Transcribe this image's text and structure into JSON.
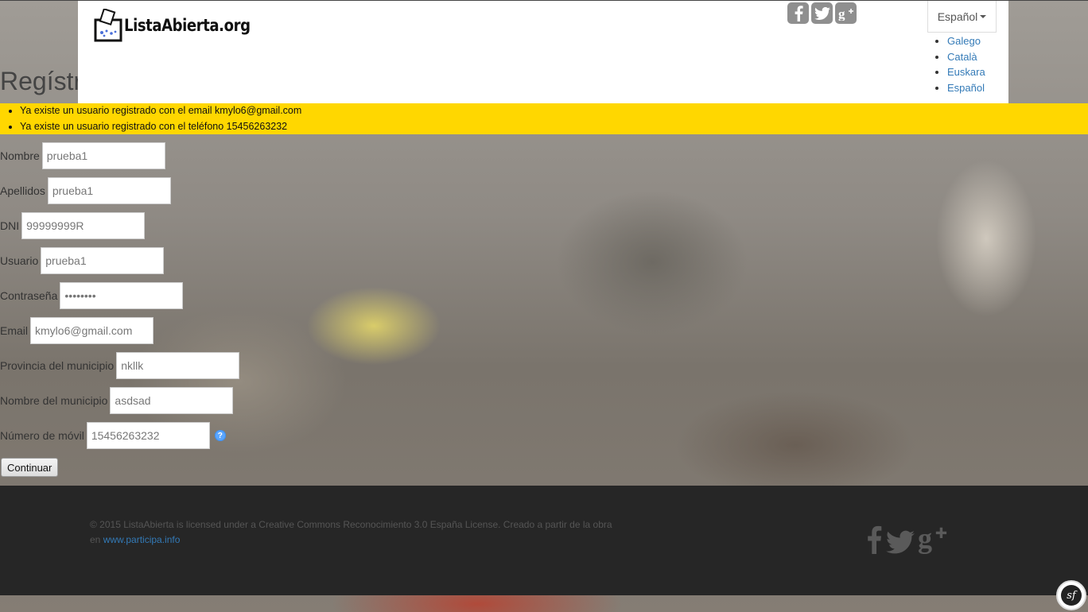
{
  "page": {
    "title": "Regístr"
  },
  "header": {
    "logo_text": "ListaAbierta.org",
    "language": {
      "current": "Español",
      "options": [
        "Galego",
        "Català",
        "Euskara",
        "Español"
      ]
    },
    "social": [
      "facebook-icon",
      "twitter-icon",
      "google-plus-icon"
    ]
  },
  "errors": [
    "Ya existe un usuario registrado con el email kmylo6@gmail.com",
    "Ya existe un usuario registrado con el teléfono 15456263232"
  ],
  "form": {
    "fields": [
      {
        "label": "Nombre",
        "value": "prueba1"
      },
      {
        "label": "Apellidos",
        "value": "prueba1"
      },
      {
        "label": "DNI",
        "value": "99999999R"
      },
      {
        "label": "Usuario",
        "value": "prueba1"
      },
      {
        "label": "Contraseña",
        "value": "••••••••"
      },
      {
        "label": "Email",
        "value": "kmylo6@gmail.com"
      },
      {
        "label": "Provincia del municipio",
        "value": "nkllk"
      },
      {
        "label": "Nombre del municipio",
        "value": "asdsad"
      },
      {
        "label": "Número de móvil",
        "value": "15456263232"
      }
    ],
    "submit_label": "Continuar"
  },
  "footer": {
    "text": "© 2015 ListaAbierta is licensed under a Creative Commons Reconocimiento 3.0 España License. Creado a partir de la obra en ",
    "link_text": "www.participa.info"
  },
  "colors": {
    "error_banner": "#ffd700",
    "link": "#337ab7",
    "footer_bg": "#262626"
  }
}
